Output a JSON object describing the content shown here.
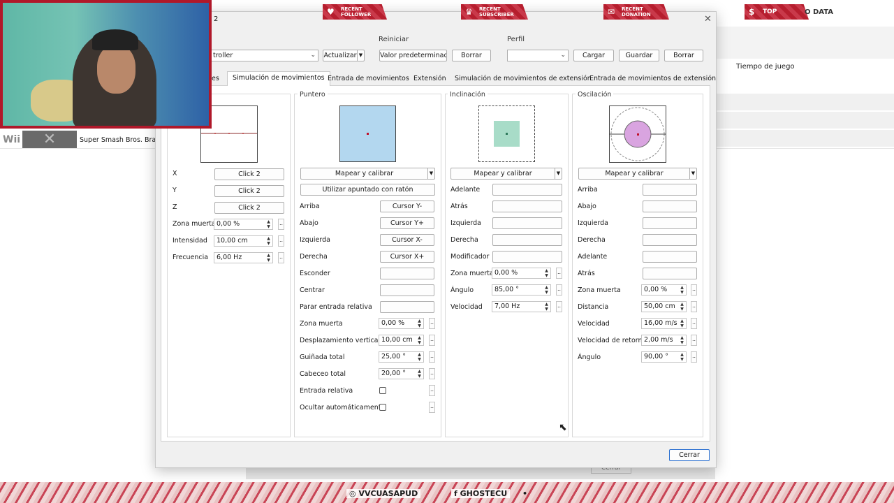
{
  "background": {
    "column_header": "Tiempo de juego",
    "platform": "Wii",
    "game_title": "Super Smash Bros. Brawl",
    "close_label": "Cerrar"
  },
  "dialog": {
    "title_fragment": "2",
    "controller_combo": "troller",
    "refresh_button": "Actualizar",
    "reset_group": "Reiniciar",
    "default_button": "Valor predeterminado",
    "clear_button": "Borrar",
    "profile_group": "Perfil",
    "profile_value": "",
    "load_button": "Cargar",
    "save_button": "Guardar",
    "delete_button": "Borrar",
    "close_button": "Cerrar",
    "tabs": [
      "es",
      "Simulación de movimientos",
      "Entrada de movimientos",
      "Extensión",
      "Simulación de movimientos de extensión",
      "Entrada de movimientos de extensión"
    ]
  },
  "shake": {
    "rows": [
      {
        "label": "X",
        "value": "Click 2"
      },
      {
        "label": "Y",
        "value": "Click 2"
      },
      {
        "label": "Z",
        "value": "Click 2"
      }
    ],
    "spins": [
      {
        "label": "Zona muerta",
        "value": "0,00 %"
      },
      {
        "label": "Intensidad",
        "value": "10,00 cm"
      },
      {
        "label": "Frecuencia",
        "value": "6,00 Hz"
      }
    ]
  },
  "pointer": {
    "title": "Puntero",
    "map_button": "Mapear y calibrar",
    "mouse_button": "Utilizar apuntado con ratón",
    "bindings": [
      {
        "label": "Arriba",
        "value": "Cursor Y-"
      },
      {
        "label": "Abajo",
        "value": "Cursor Y+"
      },
      {
        "label": "Izquierda",
        "value": "Cursor X-"
      },
      {
        "label": "Derecha",
        "value": "Cursor X+"
      },
      {
        "label": "Esconder",
        "value": ""
      },
      {
        "label": "Centrar",
        "value": ""
      },
      {
        "label": "Parar entrada relativa",
        "value": ""
      }
    ],
    "spins": [
      {
        "label": "Zona muerta",
        "value": "0,00 %"
      },
      {
        "label": "Desplazamiento vertical",
        "value": "10,00 cm"
      },
      {
        "label": "Guiñada total",
        "value": "25,00 °"
      },
      {
        "label": "Cabeceo total",
        "value": "20,00 °"
      }
    ],
    "checks": [
      {
        "label": "Entrada relativa"
      },
      {
        "label": "Ocultar automáticamente"
      }
    ]
  },
  "tilt": {
    "title": "Inclinación",
    "map_button": "Mapear y calibrar",
    "bindings": [
      {
        "label": "Adelante",
        "value": ""
      },
      {
        "label": "Atrás",
        "value": ""
      },
      {
        "label": "Izquierda",
        "value": ""
      },
      {
        "label": "Derecha",
        "value": ""
      },
      {
        "label": "Modificador",
        "value": ""
      }
    ],
    "spins": [
      {
        "label": "Zona muerta",
        "value": "0,00 %"
      },
      {
        "label": "Ángulo",
        "value": "85,00 °"
      },
      {
        "label": "Velocidad",
        "value": "7,00 Hz"
      }
    ]
  },
  "swing": {
    "title": "Oscilación",
    "map_button": "Mapear y calibrar",
    "bindings": [
      {
        "label": "Arriba",
        "value": ""
      },
      {
        "label": "Abajo",
        "value": ""
      },
      {
        "label": "Izquierda",
        "value": ""
      },
      {
        "label": "Derecha",
        "value": ""
      },
      {
        "label": "Adelante",
        "value": ""
      },
      {
        "label": "Atrás",
        "value": ""
      }
    ],
    "spins": [
      {
        "label": "Zona muerta",
        "value": "0,00 %"
      },
      {
        "label": "Distancia",
        "value": "50,00 cm"
      },
      {
        "label": "Velocidad",
        "value": "16,00 m/s"
      },
      {
        "label": "Velocidad de retorno",
        "value": "2,00 m/s"
      },
      {
        "label": "Ángulo",
        "value": "90,00 °"
      }
    ]
  },
  "overlay": {
    "alerts": [
      {
        "line1": "RECENT",
        "line2": "FOLLOWER"
      },
      {
        "line1": "RECENT",
        "line2": "SUBSCRIBER"
      },
      {
        "line1": "RECENT",
        "line2": "DONATION"
      },
      {
        "line1": "TOP DONATION",
        "line2": ""
      }
    ],
    "data_text": "O DATA",
    "footer": [
      "VVCUASAPUD",
      "GHOSTECU"
    ],
    "footer_dot": "•"
  },
  "colors": {
    "pointer_preview": "#b3d7ef",
    "tilt_preview": "#a8dcc8",
    "swing_preview": "#d9a4e0",
    "stream_accent": "#b0182a"
  }
}
